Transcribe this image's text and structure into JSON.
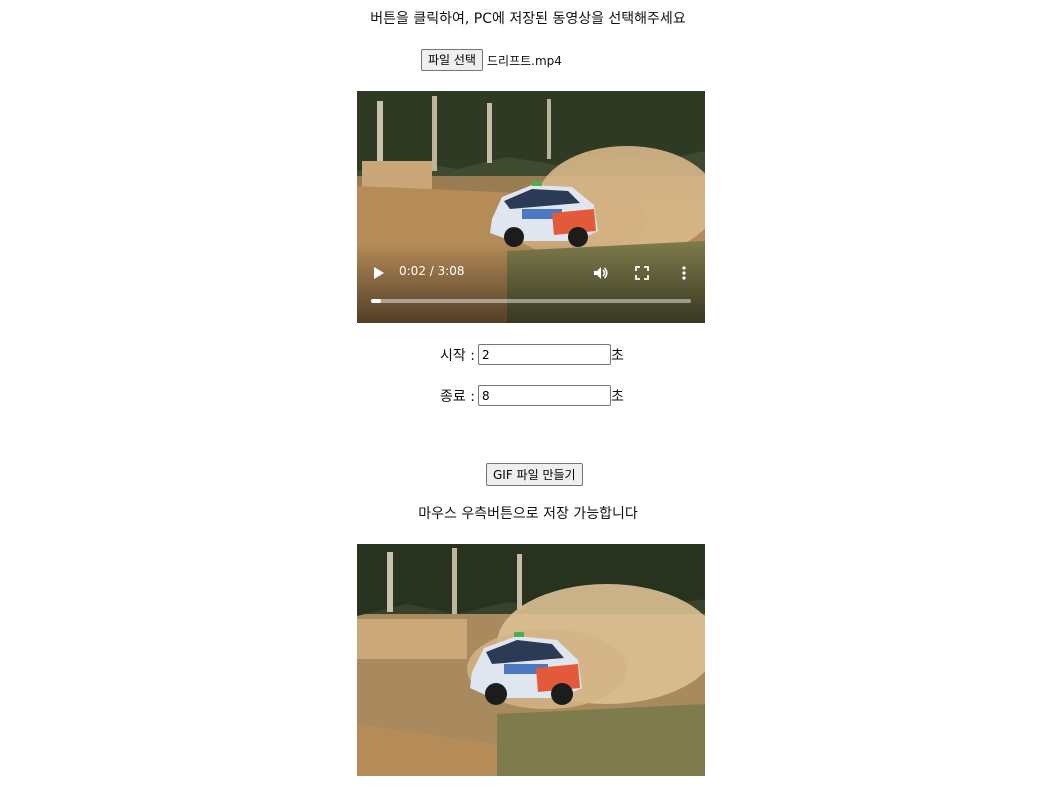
{
  "instruction_text": "버튼을 클릭하여, PC에 저장된 동영상을 선택해주세요",
  "file_input": {
    "button_label": "파일 선택",
    "file_name": "드리프트.mp4"
  },
  "video_player": {
    "time_display": "0:02 / 3:08",
    "progress_fraction": 0.03,
    "icons": [
      "play-icon",
      "volume-icon",
      "fullscreen-icon",
      "more-options-icon"
    ]
  },
  "start_field": {
    "label": "시작 :",
    "value": "2",
    "unit": "초"
  },
  "end_field": {
    "label": "종료 :",
    "value": "8",
    "unit": "초"
  },
  "make_gif_button": "GIF 파일 만들기",
  "save_hint": "마우스 우측버튼으로 저장 가능합니다",
  "colors": {
    "button_bg": "#efefef",
    "button_border": "#767676",
    "progress_fill": "#ffffff"
  }
}
